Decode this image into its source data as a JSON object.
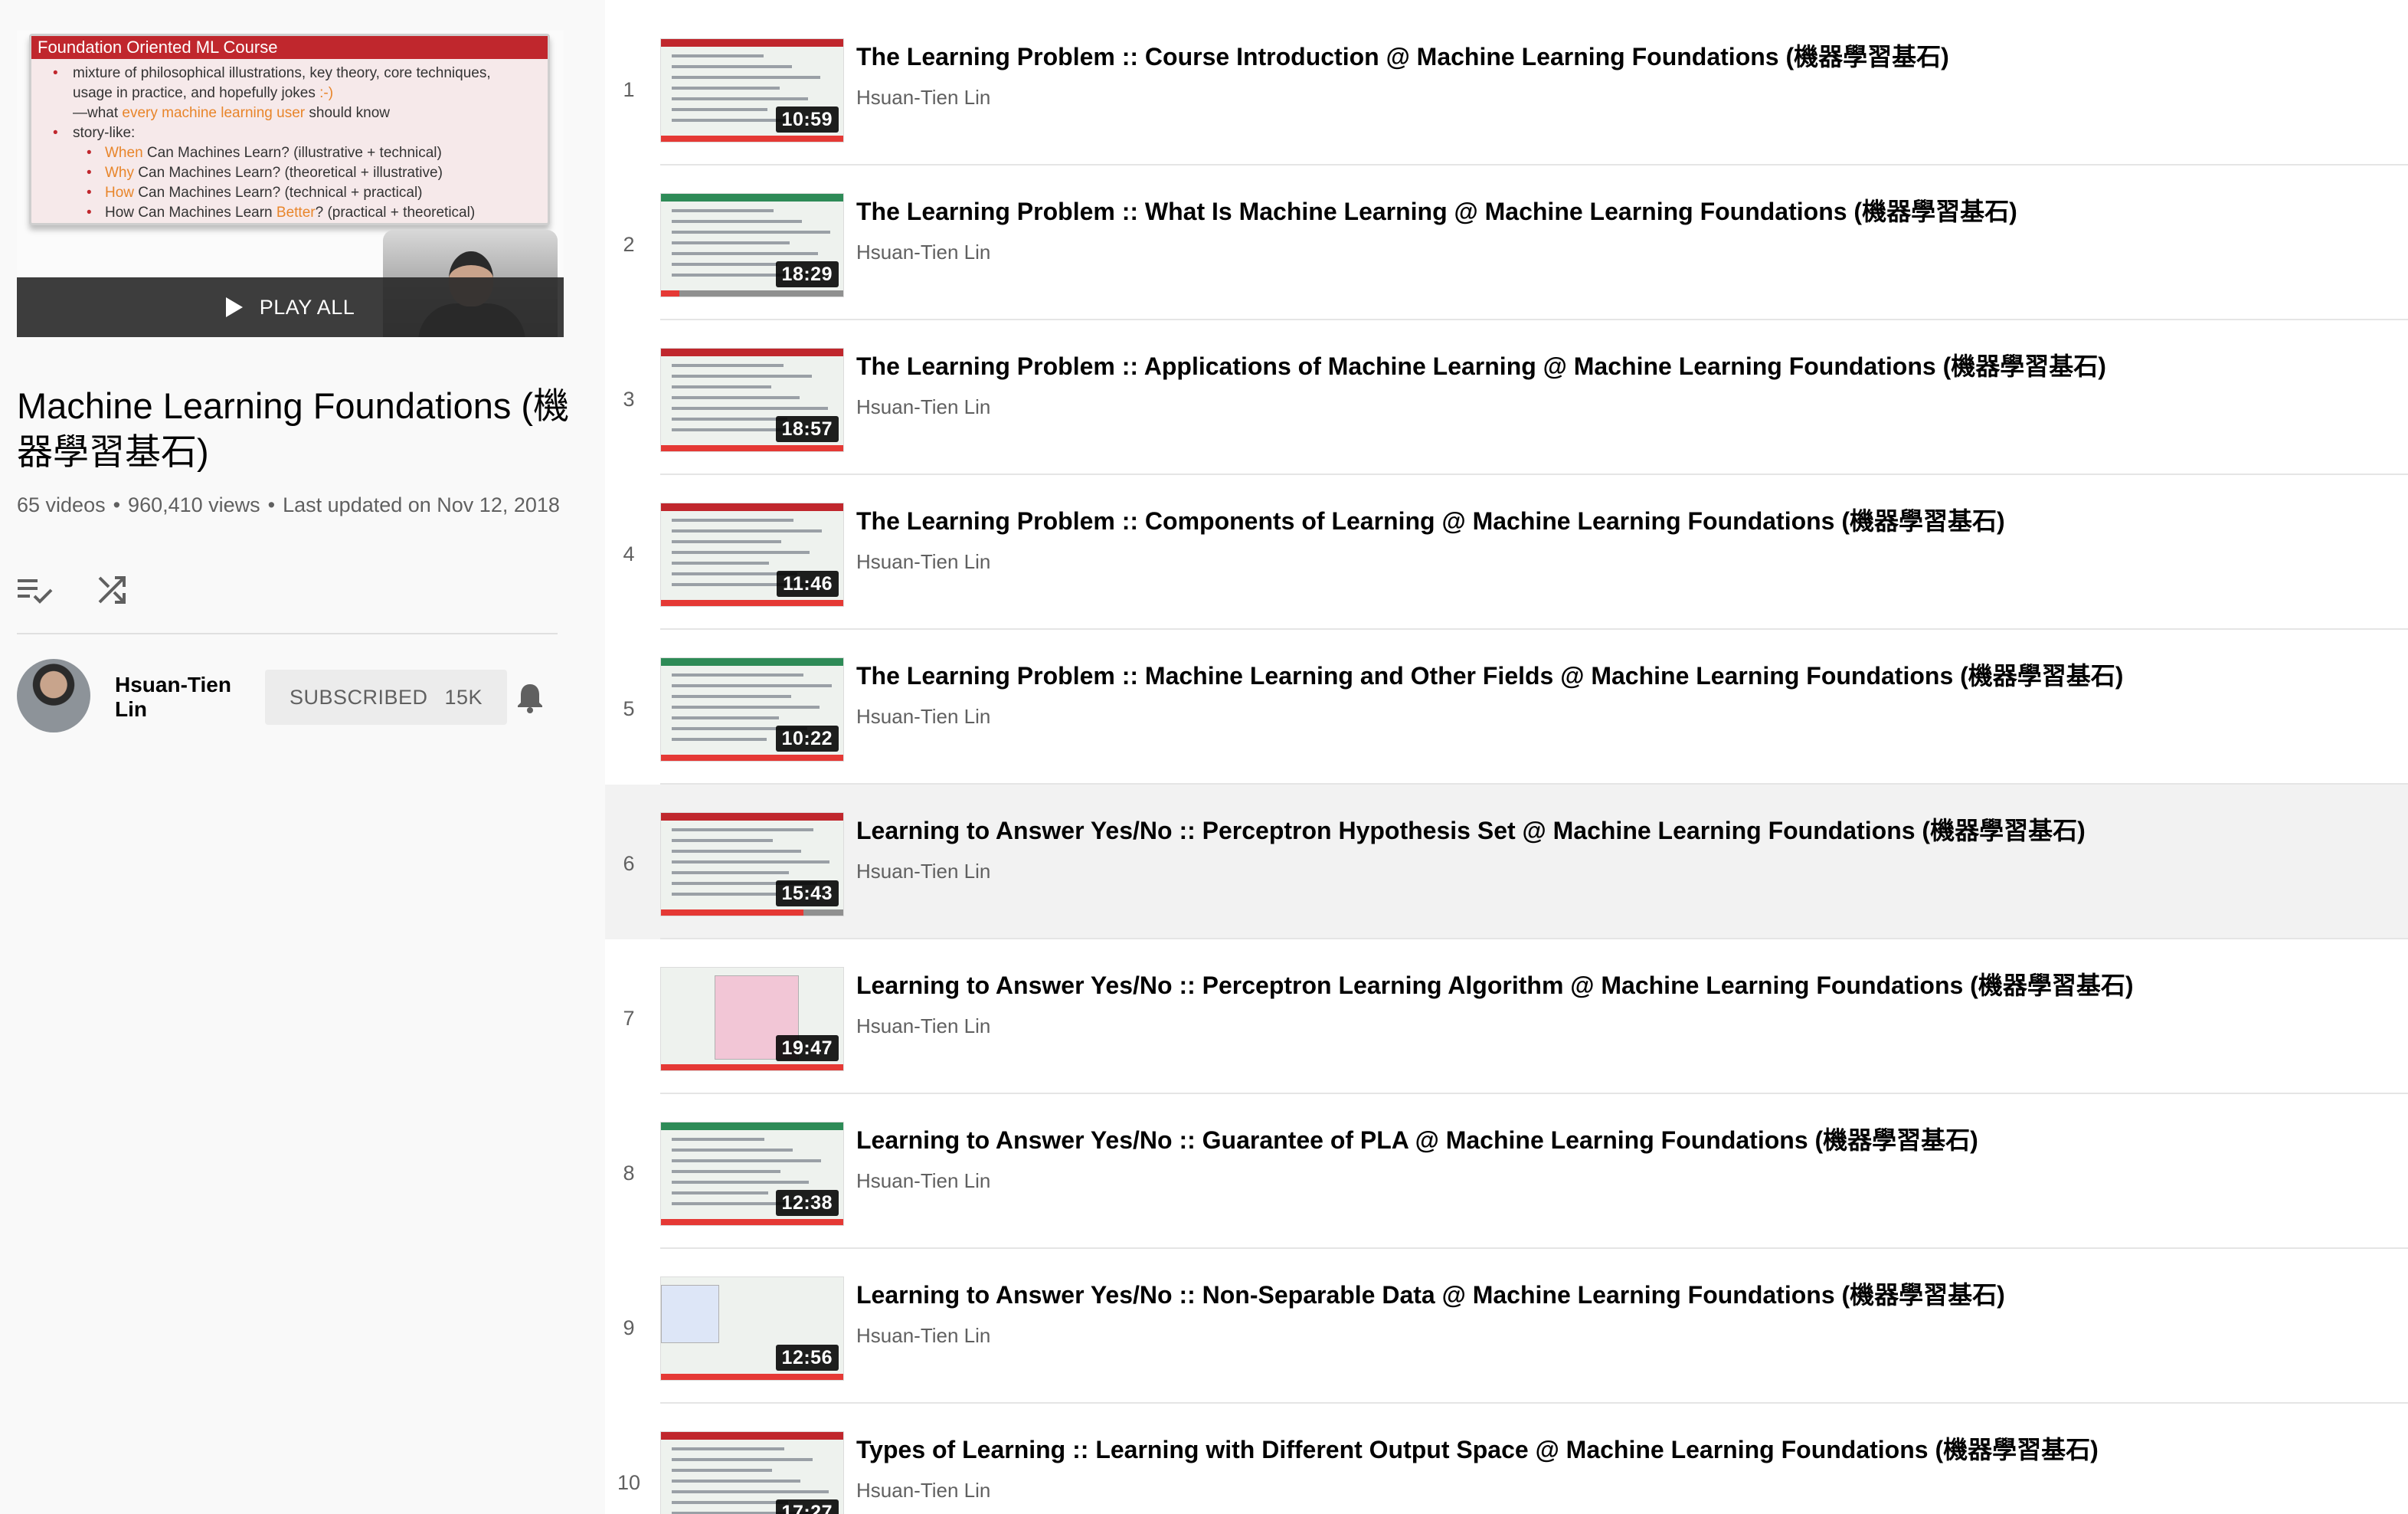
{
  "playlist": {
    "hero": {
      "slide_title": "Foundation Oriented ML Course",
      "slide_b1a": "mixture of philosophical illustrations, key theory, core techniques,",
      "slide_b1b": "usage in practice, and hopefully jokes",
      "slide_b1b_hl": ":-)",
      "slide_b1c_pre": "—what",
      "slide_b1c_hl": "every machine learning user",
      "slide_b1c_post": "should know",
      "slide_b2": "story-like:",
      "slide_s1_hl": "When",
      "slide_s1": "Can Machines Learn? (illustrative + technical)",
      "slide_s2_hl": "Why",
      "slide_s2": "Can Machines Learn? (theoretical + illustrative)",
      "slide_s3_hl": "How",
      "slide_s3": "Can Machines Learn? (technical + practical)",
      "slide_s4_pre": "How Can Machines Learn",
      "slide_s4_hl": "Better",
      "slide_s4_post": "? (practical + theoretical)",
      "play_all": "PLAY ALL"
    },
    "title": "Machine Learning Foundations (機器學習基石)",
    "video_count": "65 videos",
    "views": "960,410 views",
    "updated": "Last updated on Nov 12, 2018",
    "dot": "•",
    "owner": {
      "name": "Hsuan-Tien Lin",
      "subscribe_label": "SUBSCRIBED",
      "subscriber_count": "15K"
    }
  },
  "videos": [
    {
      "index": "1",
      "title": "The Learning Problem :: Course Introduction @ Machine Learning Foundations (機器學習基石)",
      "channel": "Hsuan-Tien Lin",
      "duration": "10:59",
      "progress": 1.0
    },
    {
      "index": "2",
      "title": "The Learning Problem :: What Is Machine Learning @ Machine Learning Foundations (機器學習基石)",
      "channel": "Hsuan-Tien Lin",
      "duration": "18:29",
      "progress": 0.1
    },
    {
      "index": "3",
      "title": "The Learning Problem :: Applications of Machine Learning @ Machine Learning Foundations (機器學習基石)",
      "channel": "Hsuan-Tien Lin",
      "duration": "18:57",
      "progress": 1.0
    },
    {
      "index": "4",
      "title": "The Learning Problem :: Components of Learning @ Machine Learning Foundations (機器學習基石)",
      "channel": "Hsuan-Tien Lin",
      "duration": "11:46",
      "progress": 1.0
    },
    {
      "index": "5",
      "title": "The Learning Problem :: Machine Learning and Other Fields @ Machine Learning Foundations (機器學習基石)",
      "channel": "Hsuan-Tien Lin",
      "duration": "10:22",
      "progress": 1.0
    },
    {
      "index": "6",
      "title": "Learning to Answer Yes/No :: Perceptron Hypothesis Set @ Machine Learning Foundations (機器學習基石)",
      "channel": "Hsuan-Tien Lin",
      "duration": "15:43",
      "progress": 0.78
    },
    {
      "index": "7",
      "title": "Learning to Answer Yes/No :: Perceptron Learning Algorithm @ Machine Learning Foundations (機器學習基石)",
      "channel": "Hsuan-Tien Lin",
      "duration": "19:47",
      "progress": 1.0
    },
    {
      "index": "8",
      "title": "Learning to Answer Yes/No :: Guarantee of PLA @ Machine Learning Foundations (機器學習基石)",
      "channel": "Hsuan-Tien Lin",
      "duration": "12:38",
      "progress": 1.0
    },
    {
      "index": "9",
      "title": "Learning to Answer Yes/No :: Non-Separable Data @ Machine Learning Foundations (機器學習基石)",
      "channel": "Hsuan-Tien Lin",
      "duration": "12:56",
      "progress": 1.0
    },
    {
      "index": "10",
      "title": "Types of Learning :: Learning with Different Output Space @ Machine Learning Foundations (機器學習基石)",
      "channel": "Hsuan-Tien Lin",
      "duration": "17:27",
      "progress": 1.0
    }
  ],
  "icons": {
    "add_to_queue": "playlist-add-check-icon",
    "shuffle": "shuffle-icon",
    "play": "play-icon",
    "bell": "notification-bell-icon"
  },
  "colors": {
    "accent_red": "#c0272d",
    "progress_red": "#e53935",
    "text_primary": "#030303",
    "text_secondary": "#606060",
    "sidebar_bg": "#f9f9f9",
    "hover_row_bg": "#f2f2f2"
  }
}
